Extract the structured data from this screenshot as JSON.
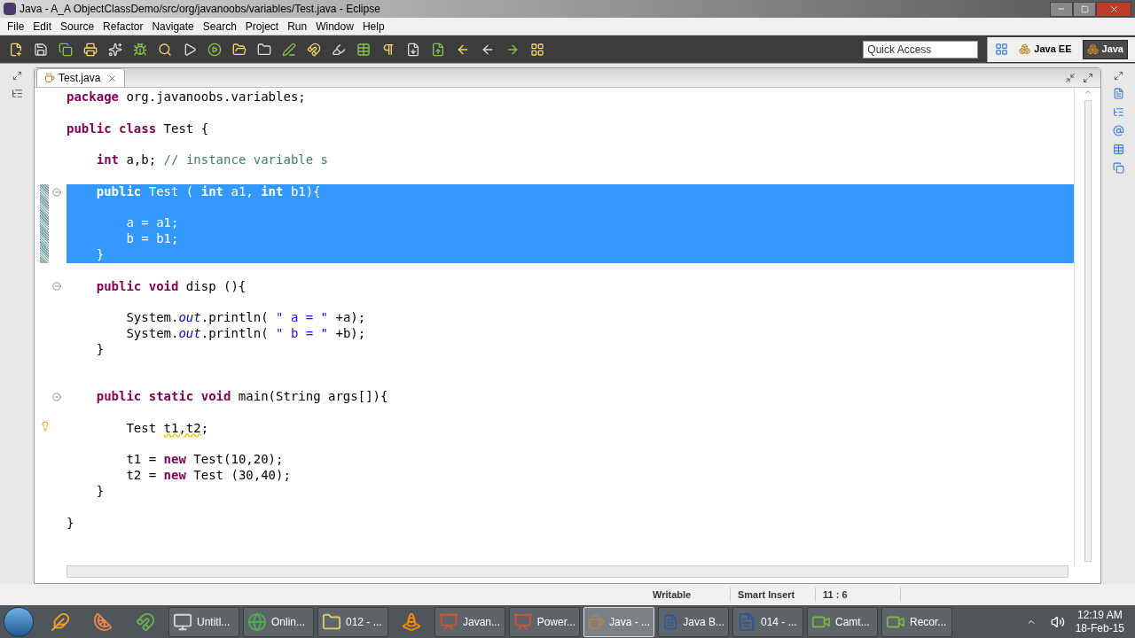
{
  "window": {
    "title": "Java - A_A ObjectClassDemo/src/org/javanoobs/variables/Test.java - Eclipse"
  },
  "menu": [
    "File",
    "Edit",
    "Source",
    "Refactor",
    "Navigate",
    "Search",
    "Project",
    "Run",
    "Window",
    "Help"
  ],
  "quick_access": {
    "placeholder": "Quick Access"
  },
  "perspectives": [
    {
      "label": "Java EE",
      "selected": false
    },
    {
      "label": "Java",
      "selected": true
    }
  ],
  "editor": {
    "tab": {
      "label": "Test.java"
    },
    "lines": [
      {
        "tokens": [
          {
            "text": "package",
            "kind": "kw"
          },
          {
            "text": " org.javanoobs.variables;",
            "kind": "plain"
          }
        ],
        "selected": false,
        "fold": false
      },
      {
        "selected": false,
        "fold": false
      },
      {
        "tokens": [
          {
            "text": "public class",
            "kind": "kw"
          },
          {
            "text": " Test {",
            "kind": "plain"
          }
        ],
        "selected": false,
        "fold": false
      },
      {
        "selected": false,
        "fold": false
      },
      {
        "tokens": [
          {
            "text": "    int",
            "kind": "kw"
          },
          {
            "text": " a,b; ",
            "kind": "plain"
          },
          {
            "text": "// instance variable s",
            "kind": "comment"
          }
        ],
        "selected": false,
        "fold": false
      },
      {
        "selected": false,
        "fold": false
      },
      {
        "tokens": [
          {
            "text": "    public",
            "kind": "kw"
          },
          {
            "text": " Test ( ",
            "kind": "plain"
          },
          {
            "text": "int",
            "kind": "kw"
          },
          {
            "text": " a1, ",
            "kind": "plain"
          },
          {
            "text": "int",
            "kind": "kw"
          },
          {
            "text": " b1){",
            "kind": "plain"
          }
        ],
        "selected": true,
        "fold": true
      },
      {
        "selected": true,
        "fold": false
      },
      {
        "tokens": [
          {
            "text": "        a = a1;",
            "kind": "plain"
          }
        ],
        "selected": true,
        "fold": false
      },
      {
        "tokens": [
          {
            "text": "        b = b1;",
            "kind": "plain"
          }
        ],
        "selected": true,
        "fold": false
      },
      {
        "tokens": [
          {
            "text": "    }",
            "kind": "plain"
          }
        ],
        "selected": true,
        "fold": false
      },
      {
        "selected": false,
        "fold": false
      },
      {
        "tokens": [
          {
            "text": "    public void",
            "kind": "kw"
          },
          {
            "text": " disp (){",
            "kind": "plain"
          }
        ],
        "selected": false,
        "fold": true
      },
      {
        "selected": false,
        "fold": false
      },
      {
        "tokens": [
          {
            "text": "        System.",
            "kind": "plain"
          },
          {
            "text": "out",
            "kind": "static"
          },
          {
            "text": ".println( ",
            "kind": "plain"
          },
          {
            "text": "\" a = \"",
            "kind": "string"
          },
          {
            "text": " +a);",
            "kind": "plain"
          }
        ],
        "selected": false,
        "fold": false
      },
      {
        "tokens": [
          {
            "text": "        System.",
            "kind": "plain"
          },
          {
            "text": "out",
            "kind": "static"
          },
          {
            "text": ".println( ",
            "kind": "plain"
          },
          {
            "text": "\" b = \"",
            "kind": "string"
          },
          {
            "text": " +b);",
            "kind": "plain"
          }
        ],
        "selected": false,
        "fold": false
      },
      {
        "tokens": [
          {
            "text": "    }",
            "kind": "plain"
          }
        ],
        "selected": false,
        "fold": false
      },
      {
        "selected": false,
        "fold": false
      },
      {
        "selected": false,
        "fold": false
      },
      {
        "tokens": [
          {
            "text": "    public static void",
            "kind": "kw"
          },
          {
            "text": " main(String args[]){",
            "kind": "plain"
          }
        ],
        "selected": false,
        "fold": true
      },
      {
        "selected": false,
        "fold": false
      },
      {
        "tokens": [
          {
            "text": "        Test ",
            "kind": "plain"
          },
          {
            "text": "t1,t2",
            "kind": "warn"
          },
          {
            "text": ";",
            "kind": "plain"
          }
        ],
        "selected": false,
        "fold": false,
        "warning": true
      },
      {
        "selected": false,
        "fold": false
      },
      {
        "tokens": [
          {
            "text": "        t1 = ",
            "kind": "plain"
          },
          {
            "text": "new",
            "kind": "kw"
          },
          {
            "text": " Test(10,20);",
            "kind": "plain"
          }
        ],
        "selected": false,
        "fold": false
      },
      {
        "tokens": [
          {
            "text": "        t2 = ",
            "kind": "plain"
          },
          {
            "text": "new",
            "kind": "kw"
          },
          {
            "text": " Test (30,40);",
            "kind": "plain"
          }
        ],
        "selected": false,
        "fold": false
      },
      {
        "tokens": [
          {
            "text": "    }",
            "kind": "plain"
          }
        ],
        "selected": false,
        "fold": false
      },
      {
        "selected": false,
        "fold": false
      },
      {
        "tokens": [
          {
            "text": "}",
            "kind": "plain"
          }
        ],
        "selected": false,
        "fold": false
      }
    ]
  },
  "status_bar": [
    "Writable",
    "Smart Insert",
    "11 : 6"
  ],
  "taskbar": {
    "items": [
      {
        "kind": "pinned",
        "selected": false
      },
      {
        "kind": "pinned",
        "selected": false
      },
      {
        "kind": "pinned",
        "selected": false
      },
      {
        "kind": "window",
        "label": "Untitl...",
        "selected": false
      },
      {
        "kind": "window",
        "label": "Onlin...",
        "selected": false
      },
      {
        "kind": "window",
        "label": "012 - ...",
        "selected": false
      },
      {
        "kind": "pinned",
        "selected": false
      },
      {
        "kind": "window",
        "label": "Javan...",
        "selected": false
      },
      {
        "kind": "window",
        "label": "Power...",
        "selected": false
      },
      {
        "kind": "window",
        "label": "Java - ...",
        "selected": true
      },
      {
        "kind": "window",
        "label": "Java B...",
        "selected": false
      },
      {
        "kind": "window",
        "label": "014 - ...",
        "selected": false
      },
      {
        "kind": "window",
        "label": "Camt...",
        "selected": false
      },
      {
        "kind": "window",
        "label": "Recor...",
        "selected": false
      }
    ],
    "clock": {
      "time": "12:19 AM",
      "date": "18-Feb-15"
    }
  }
}
